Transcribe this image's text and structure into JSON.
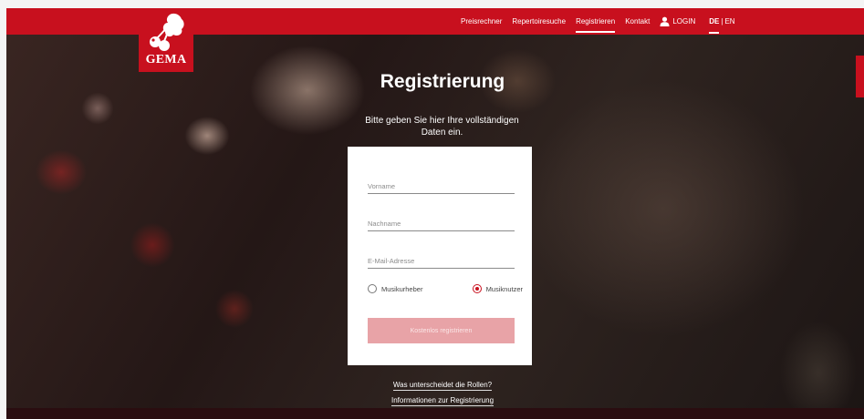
{
  "brand": {
    "logo_text": "GEMA",
    "primary_color": "#c8101e"
  },
  "nav": {
    "items": [
      "Preisrechner",
      "Repertoiresuche",
      "Registrieren",
      "Kontakt"
    ],
    "active": "Registrieren",
    "login_label": "LOGIN",
    "lang_de": "DE",
    "lang_sep": "|",
    "lang_en": "EN"
  },
  "page": {
    "title": "Registrierung",
    "subtitle": "Bitte geben Sie hier Ihre vollständigen Daten ein."
  },
  "form": {
    "first_name_placeholder": "Vorname",
    "last_name_placeholder": "Nachname",
    "email_placeholder": "E-Mail-Adresse",
    "role_options": [
      "Musikurheber",
      "Musiknutzer"
    ],
    "selected_role": "Musiknutzer",
    "submit_label": "Kostenlos registrieren"
  },
  "links": {
    "roles_info": "Was unterscheidet die Rollen?",
    "registration_info": "Informationen zur Registrierung"
  }
}
